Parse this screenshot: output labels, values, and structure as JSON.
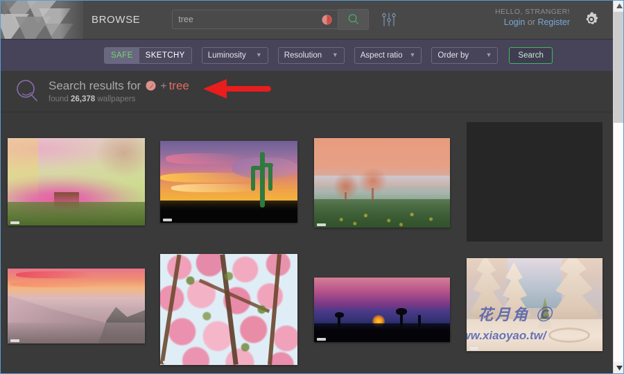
{
  "header": {
    "logo_name": "wallhaven-logo",
    "browse_label": "BROWSE",
    "search": {
      "value": "tree",
      "placeholder": "tree",
      "tag_icon": "purity-circle-icon",
      "go_icon": "search-icon",
      "sliders_icon": "sliders-icon"
    },
    "user": {
      "greeting": "HELLO, STRANGER!",
      "login_label": "Login",
      "or_label": "or",
      "register_label": "Register"
    },
    "settings_icon": "gear-icon"
  },
  "filters": {
    "purity": [
      {
        "label": "SAFE",
        "active": true
      },
      {
        "label": "SKETCHY",
        "active": false
      }
    ],
    "dropdowns": [
      {
        "label": "Luminosity"
      },
      {
        "label": "Resolution"
      },
      {
        "label": "Aspect ratio"
      },
      {
        "label": "Order by"
      }
    ],
    "search_button": "Search"
  },
  "results": {
    "magnifier_icon": "search-icon",
    "title_prefix": "Search results for",
    "query_chip_icon": "purity-circle-icon",
    "plus": "+",
    "keyword": "tree",
    "found_prefix": "found",
    "found_count": "26,378",
    "found_suffix": "wallpapers",
    "annotation_icon": "red-arrow-left-icon"
  },
  "thumbnails": [
    {
      "id": "thumb-1",
      "alt": "pink blossom tree painting",
      "watermark": ""
    },
    {
      "id": "thumb-2",
      "alt": "desert cactus sunset",
      "watermark": ""
    },
    {
      "id": "thumb-3",
      "alt": "foggy meadow with trees",
      "watermark": ""
    },
    {
      "id": "thumb-4",
      "alt": "unloaded placeholder",
      "watermark": ""
    },
    {
      "id": "thumb-5",
      "alt": "pink sunset mountain valley",
      "watermark": ""
    },
    {
      "id": "thumb-6",
      "alt": "cherry blossom close-up",
      "watermark": ""
    },
    {
      "id": "thumb-7",
      "alt": "purple twilight sunset trees",
      "watermark": ""
    },
    {
      "id": "thumb-8",
      "alt": "snow covered winter forest",
      "watermark": "http://www.xiaoyao.tw/"
    }
  ],
  "scrollbar": {
    "up_icon": "triangle-up-icon",
    "down_icon": "triangle-down-icon"
  },
  "colors": {
    "header_bg": "#484848",
    "filter_bg": "#474459",
    "page_bg": "#3a3a3a",
    "accent_green": "#3fba5c",
    "safe_green": "#72d96a",
    "link_blue": "#7ba7d7",
    "keyword_red": "#e06a5f",
    "annotation_red": "#e81d1d",
    "magnifier_purple": "#8a6fae"
  }
}
